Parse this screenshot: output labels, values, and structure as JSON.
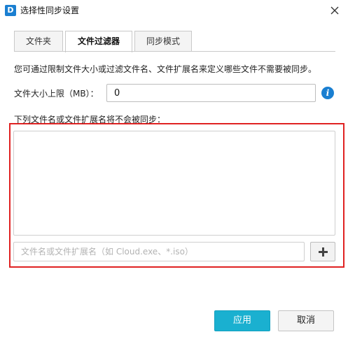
{
  "window": {
    "title": "选择性同步设置",
    "icon_letter": "D",
    "icon": "app-logo-icon",
    "close_icon": "close-icon"
  },
  "tabs": [
    {
      "label": "文件夹",
      "active": false
    },
    {
      "label": "文件过滤器",
      "active": true
    },
    {
      "label": "同步模式",
      "active": false
    }
  ],
  "filter": {
    "description": "您可通过限制文件大小或过滤文件名、文件扩展名来定义哪些文件不需要被同步。",
    "size_label": "文件大小上限（MB）：",
    "size_value": "0",
    "info_icon": "info-icon",
    "list_label": "下列文件名或文件扩展名将不会被同步：",
    "excluded_items": [],
    "pattern_placeholder": "文件名或文件扩展名（如 Cloud.exe、*.iso）",
    "pattern_value": "",
    "add_icon": "plus-icon"
  },
  "footer": {
    "apply_label": "应用",
    "cancel_label": "取消"
  },
  "colors": {
    "accent": "#1ab0d0",
    "highlight_border": "#e02222",
    "info_icon": "#1a7fd1"
  }
}
